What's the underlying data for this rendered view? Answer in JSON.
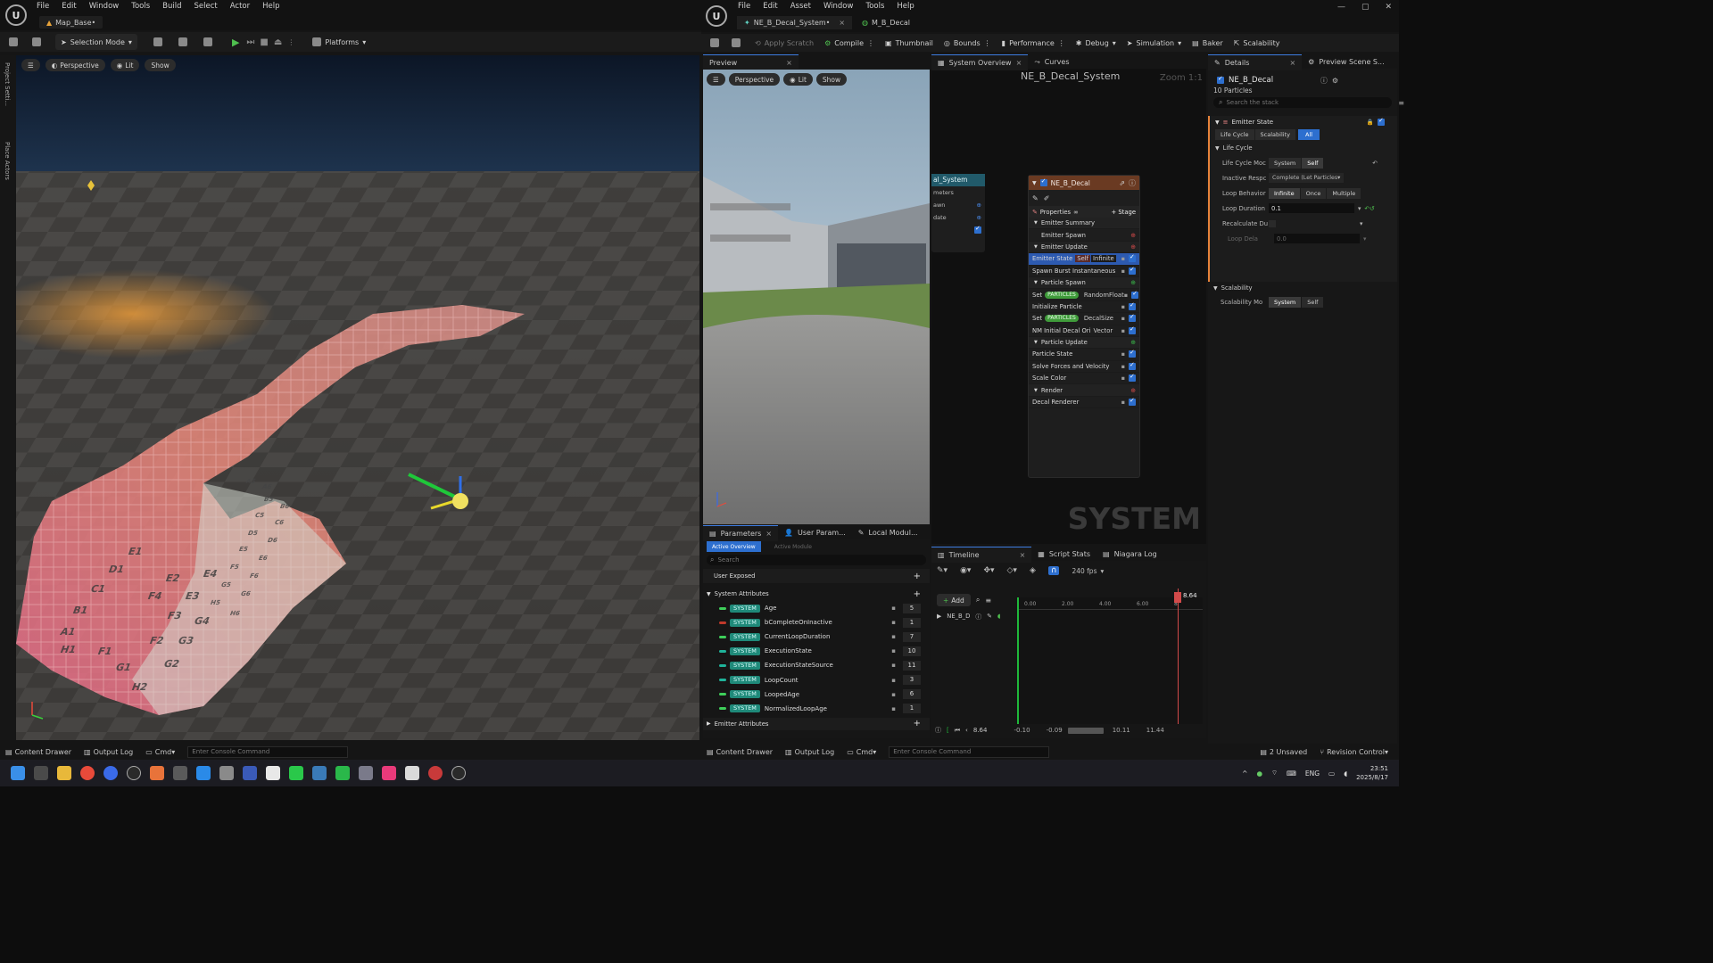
{
  "left_editor": {
    "menu": [
      "File",
      "Edit",
      "Window",
      "Tools",
      "Build",
      "Select",
      "Actor",
      "Help"
    ],
    "map_tab": "Map_Base•",
    "toolbar": {
      "selection_mode": "Selection Mode",
      "platforms": "Platforms"
    },
    "viewport": {
      "perspective": "Perspective",
      "lit": "Lit",
      "show": "Show"
    },
    "side_labels": [
      "Project Setti...",
      "Place Actors"
    ],
    "tile_labels": [
      "A5",
      "A6",
      "B5",
      "B6",
      "C5",
      "C6",
      "D5",
      "D6",
      "E5",
      "E6",
      "F5",
      "F6",
      "G5",
      "G6",
      "H5",
      "H6",
      "A1",
      "B1",
      "C1",
      "D1",
      "E1",
      "F1",
      "F2",
      "G1",
      "G2",
      "H1",
      "H2",
      "G3",
      "G4",
      "F3",
      "F4",
      "E2",
      "E3",
      "E4"
    ],
    "bottom": {
      "content_drawer": "Content Drawer",
      "output_log": "Output Log",
      "cmd": "Cmd",
      "console_placeholder": "Enter Console Command"
    }
  },
  "niagara_editor": {
    "menu": [
      "File",
      "Edit",
      "Asset",
      "Window",
      "Tools",
      "Help"
    ],
    "tabs": [
      {
        "label": "NE_B_Decal_System•"
      },
      {
        "label": "M_B_Decal"
      }
    ],
    "toolbar": {
      "apply_scratch": "Apply Scratch",
      "compile": "Compile",
      "thumbnail": "Thumbnail",
      "bounds": "Bounds",
      "performance": "Performance",
      "debug": "Debug",
      "simulation": "Simulation",
      "baker": "Baker",
      "scalability": "Scalability"
    },
    "preview": {
      "tab": "Preview",
      "perspective": "Perspective",
      "lit": "Lit",
      "show": "Show"
    },
    "overview": {
      "tabs": [
        "System Overview",
        "Curves"
      ],
      "title": "NE_B_Decal_System",
      "zoom": "Zoom 1:1",
      "watermark": "SYSTEM",
      "system_node": {
        "title": "al_System",
        "rows": [
          "meters",
          "awn",
          "date",
          ""
        ]
      },
      "emitter_node": {
        "title": "NE_B_Decal",
        "properties": "Properties",
        "stage": "+ Stage",
        "rows": [
          {
            "label": "Emitter Summary",
            "type": "section"
          },
          {
            "label": "Emitter Spawn",
            "type": "sub"
          },
          {
            "label": "Emitter Update",
            "type": "section"
          },
          {
            "label": "Emitter State",
            "type": "item",
            "tag1": "Self",
            "tag2": "Infinite"
          },
          {
            "label": "Spawn Burst Instantaneous",
            "type": "item"
          },
          {
            "label": "Particle Spawn",
            "type": "section"
          },
          {
            "label": "Set",
            "type": "item",
            "part": "PARTICLES",
            "tail": "RandomFloat"
          },
          {
            "label": "Initialize Particle",
            "type": "item"
          },
          {
            "label": "Set",
            "type": "item",
            "part": "PARTICLES",
            "tail": "DecalSize"
          },
          {
            "label": "NM Initial Decal Ori",
            "type": "item",
            "tail": "Vector"
          },
          {
            "label": "Particle Update",
            "type": "section"
          },
          {
            "label": "Particle State",
            "type": "item"
          },
          {
            "label": "Solve Forces and Velocity",
            "type": "item"
          },
          {
            "label": "Scale Color",
            "type": "item"
          },
          {
            "label": "Render",
            "type": "section"
          },
          {
            "label": "Decal Renderer",
            "type": "item"
          }
        ]
      }
    },
    "details": {
      "tab": "Details",
      "tab2": "Preview Scene S...",
      "title": "NE_B_Decal",
      "particles": "10 Particles",
      "search_placeholder": "Search the stack",
      "emitter_state": "Emitter State",
      "filter_tabs": [
        "Life Cycle",
        "Scalability",
        "All"
      ],
      "life_cycle": "Life Cycle",
      "rows": [
        {
          "label": "Life Cycle Moc",
          "a": "System",
          "b": "Self"
        },
        {
          "label": "Inactive Respc",
          "dropdown": "Complete (Let Particles"
        },
        {
          "label": "Loop Behavior",
          "a": "Infinite",
          "b": "Once",
          "c": "Multiple"
        },
        {
          "label": "Loop Duration",
          "value": "0.1"
        },
        {
          "label": "Recalculate Du",
          "value": ""
        },
        {
          "label": "Loop Dela",
          "value": "0.0"
        }
      ],
      "scalability": "Scalability",
      "scal_row": {
        "label": "Scalability Mo",
        "a": "System",
        "b": "Self"
      }
    },
    "parameters": {
      "tabs": [
        "Parameters",
        "User Param...",
        "Local Modul..."
      ],
      "subtabs": [
        "Active Overview",
        "Active Module"
      ],
      "search_placeholder": "Search",
      "user_exposed": "User Exposed",
      "system_attributes": "System Attributes",
      "attributes": [
        {
          "name": "Age",
          "value": "5",
          "color": "#3ecf5a"
        },
        {
          "name": "bCompleteOnInactive",
          "value": "1",
          "color": "#c0392b"
        },
        {
          "name": "CurrentLoopDuration",
          "value": "7",
          "color": "#3ecf5a"
        },
        {
          "name": "ExecutionState",
          "value": "10",
          "color": "#1fb39a"
        },
        {
          "name": "ExecutionStateSource",
          "value": "11",
          "color": "#1fb39a"
        },
        {
          "name": "LoopCount",
          "value": "3",
          "color": "#1fb39a"
        },
        {
          "name": "LoopedAge",
          "value": "6",
          "color": "#3ecf5a"
        },
        {
          "name": "NormalizedLoopAge",
          "value": "1",
          "color": "#3ecf5a"
        }
      ],
      "sys_tag": "SYSTEM",
      "emitter_attributes": "Emitter Attributes"
    },
    "timeline": {
      "tabs": [
        "Timeline",
        "Script Stats",
        "Niagara Log"
      ],
      "fps": "240 fps",
      "add": "Add",
      "track": "NE_B_D",
      "ticks": [
        "0.00",
        "2.00",
        "4.00",
        "6.00",
        "8"
      ],
      "playhead": "8.64",
      "current": "8.64",
      "range": [
        "-0.10",
        "-0.09",
        "10.11",
        "11.44"
      ]
    },
    "bottom": {
      "content_drawer": "Content Drawer",
      "output_log": "Output Log",
      "cmd": "Cmd",
      "console_placeholder": "Enter Console Command",
      "unsaved": "2 Unsaved",
      "revision": "Revision Control"
    }
  },
  "taskbar": {
    "lang": "ENG",
    "time": "23:51",
    "date": "2025/8/17"
  }
}
